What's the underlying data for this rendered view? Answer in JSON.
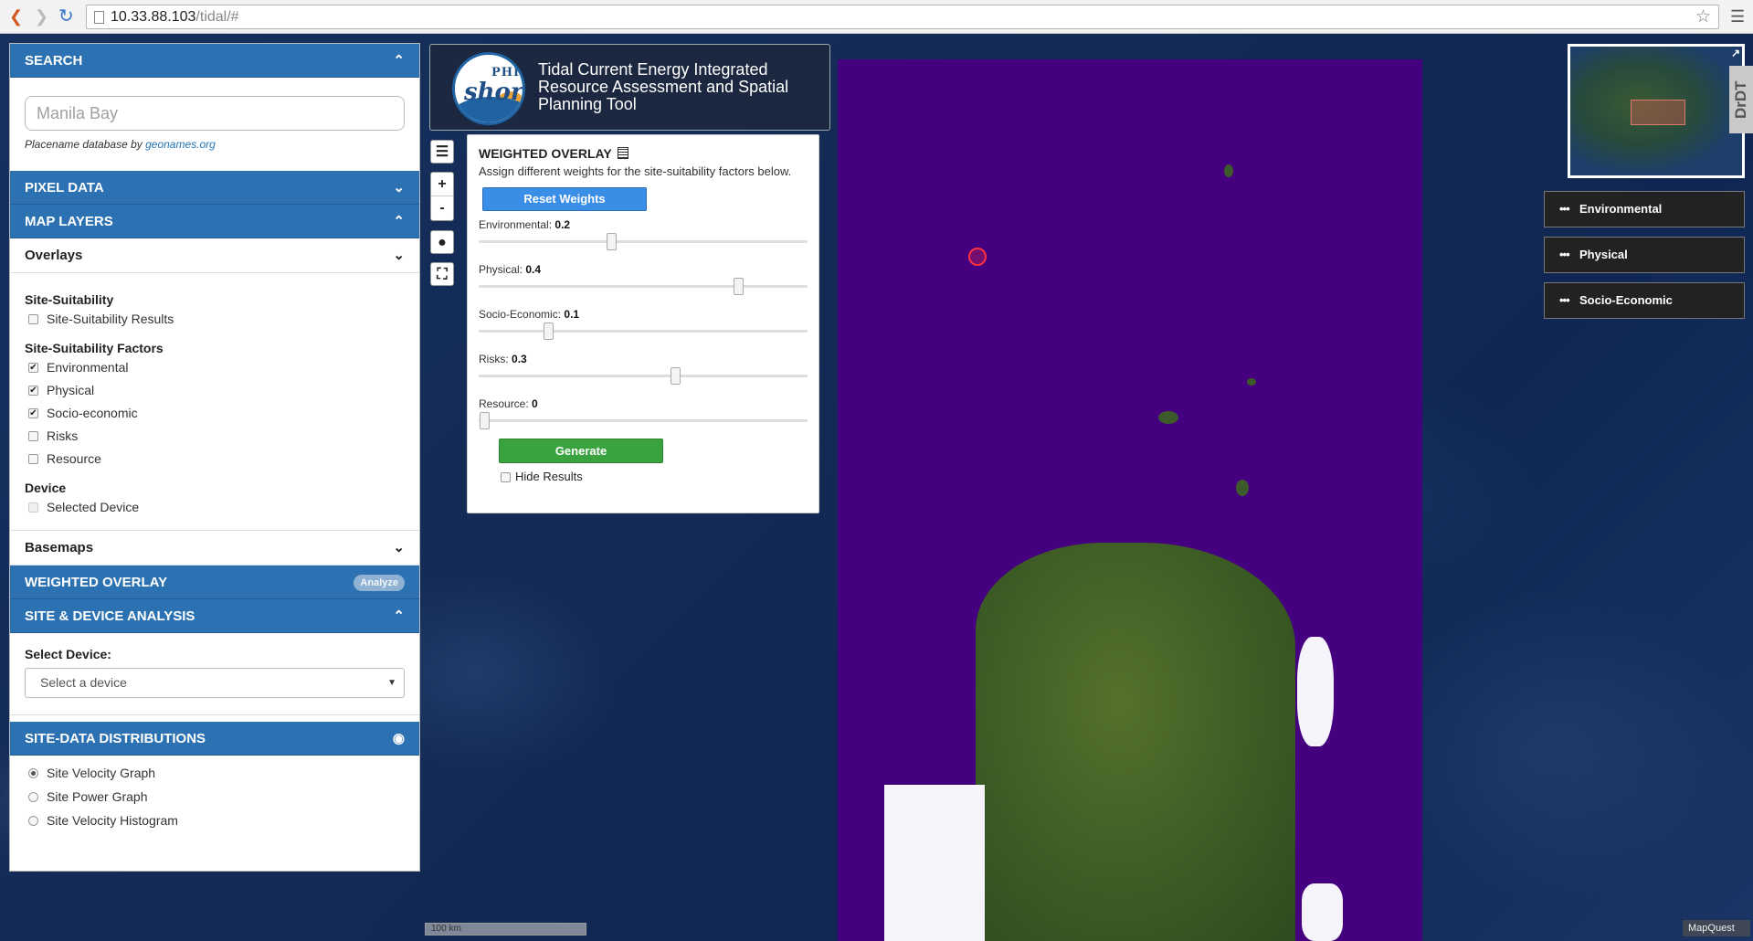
{
  "browser": {
    "url_host": "10.33.88.103",
    "url_path": "/tidal/#"
  },
  "sidebar": {
    "search": {
      "title": "SEARCH",
      "placeholder": "Manila Bay",
      "credit_prefix": "Placename database by ",
      "credit_link": "geonames.org"
    },
    "pixel_data": {
      "title": "PIXEL DATA"
    },
    "map_layers": {
      "title": "MAP LAYERS",
      "overlays_title": "Overlays",
      "groups": [
        {
          "title": "Site-Suitability",
          "items": [
            {
              "label": "Site-Suitability Results",
              "checked": false
            }
          ]
        },
        {
          "title": "Site-Suitability Factors",
          "items": [
            {
              "label": "Environmental",
              "checked": true
            },
            {
              "label": "Physical",
              "checked": true
            },
            {
              "label": "Socio-economic",
              "checked": true
            },
            {
              "label": "Risks",
              "checked": false
            },
            {
              "label": "Resource",
              "checked": false
            }
          ]
        },
        {
          "title": "Device",
          "items": [
            {
              "label": "Selected Device",
              "checked": false,
              "disabled": true
            }
          ]
        }
      ],
      "basemaps_title": "Basemaps"
    },
    "weighted_overlay": {
      "title": "WEIGHTED OVERLAY",
      "badge": "Analyze"
    },
    "site_device": {
      "title": "SITE & DEVICE ANALYSIS",
      "select_label": "Select Device:",
      "select_value": "Select a device"
    },
    "distributions": {
      "title": "SITE-DATA DISTRIBUTIONS",
      "options": [
        {
          "label": "Site Velocity Graph",
          "selected": true
        },
        {
          "label": "Site Power Graph",
          "selected": false
        },
        {
          "label": "Site Velocity Histogram",
          "selected": false
        }
      ]
    }
  },
  "banner": {
    "logo_top": "PHIL",
    "logo_main": "shore",
    "title": "Tidal Current Energy Integrated Resource Assessment and Spatial Planning Tool"
  },
  "controls": {
    "zoom_in": "+",
    "zoom_out": "-"
  },
  "weighted_panel": {
    "title": "WEIGHTED OVERLAY",
    "description": "Assign different weights for the site-suitability factors below.",
    "reset_label": "Reset Weights",
    "sliders": [
      {
        "label": "Environmental:",
        "value": 0.2
      },
      {
        "label": "Physical:",
        "value": 0.4
      },
      {
        "label": "Socio-Economic:",
        "value": 0.1
      },
      {
        "label": "Risks:",
        "value": 0.3
      },
      {
        "label": "Resource:",
        "value": 0
      }
    ],
    "generate_label": "Generate",
    "hide_results_label": "Hide Results"
  },
  "legend_buttons": [
    {
      "label": "Environmental"
    },
    {
      "label": "Physical"
    },
    {
      "label": "Socio-Economic"
    }
  ],
  "drag_tab": "DrDT",
  "scale": "100 km",
  "attribution": "MapQuest",
  "colors": {
    "header_blue": "#2c72b2",
    "overlay_purple": "#45007f",
    "generate_green": "#3aa33f",
    "reset_blue": "#3b8ee6"
  }
}
